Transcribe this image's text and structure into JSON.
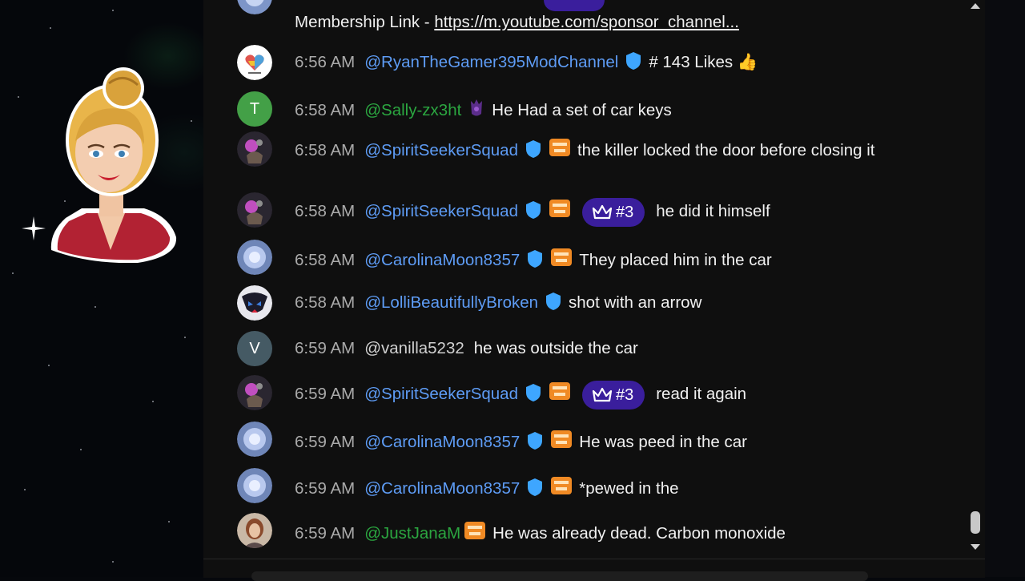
{
  "header_partial": {
    "label": "Membership Link - ",
    "link": "https://m.youtube.com/sponsor_channel..."
  },
  "messages": [
    {
      "time": "6:56 AM",
      "author": "@RyanTheGamer395ModChannel",
      "text": "# 143 Likes 👍",
      "avatar": "heart-logo-avatar"
    },
    {
      "time": "6:58 AM",
      "author": "@Sally-zx3ht",
      "text": "He Had a set of car keys",
      "avatar": "letter-t-avatar",
      "avatar_letter": "T"
    },
    {
      "time": "6:58 AM",
      "author": "@SpiritSeekerSquad",
      "text": "the killer locked the door before closing it",
      "avatar": "skull-avatar"
    },
    {
      "time": "6:58 AM",
      "author": "@SpiritSeekerSquad",
      "rank": "#3",
      "text": "he did it himself",
      "avatar": "skull-avatar"
    },
    {
      "time": "6:58 AM",
      "author": "@CarolinaMoon8357",
      "text": "They placed him in the car",
      "avatar": "orb-avatar"
    },
    {
      "time": "6:58 AM",
      "author": "@LolliBeautifullyBroken",
      "text": "shot with an arrow",
      "avatar": "mask-avatar"
    },
    {
      "time": "6:59 AM",
      "author": "@vanilla5232",
      "text": "he was outside the car",
      "avatar": "letter-v-avatar",
      "avatar_letter": "V"
    },
    {
      "time": "6:59 AM",
      "author": "@SpiritSeekerSquad",
      "rank": "#3",
      "text": "read it again",
      "avatar": "skull-avatar"
    },
    {
      "time": "6:59 AM",
      "author": "@CarolinaMoon8357",
      "text": "He was peed in the car",
      "avatar": "orb-avatar"
    },
    {
      "time": "6:59 AM",
      "author": "@CarolinaMoon8357",
      "text": "*pewed in the",
      "avatar": "orb-avatar"
    },
    {
      "time": "6:59 AM",
      "author": "@JustJanaM",
      "text": "He was already dead. Carbon monoxide",
      "avatar": "woman-photo-avatar"
    }
  ],
  "colors": {
    "chat_bg": "#0f0f0f",
    "moderator_name": "#5e9cf5",
    "member_name": "#2ba640",
    "rank_badge": "#3a1e9c",
    "timestamp": "#aaaaaa"
  }
}
